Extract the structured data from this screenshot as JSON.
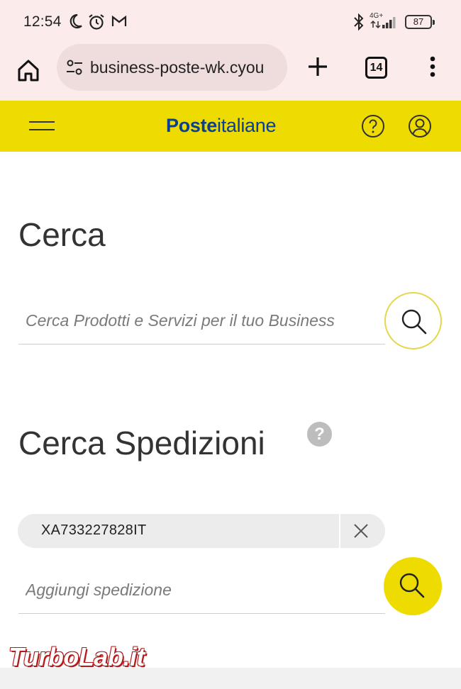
{
  "status_bar": {
    "time": "12:54",
    "network": "4G+",
    "battery": "87"
  },
  "browser": {
    "url": "business-poste-wk.cyou",
    "tab_count": "14"
  },
  "site_header": {
    "logo_bold": "Poste",
    "logo_rest": "italiane"
  },
  "search": {
    "heading": "Cerca",
    "placeholder": "Cerca Prodotti e Servizi per il tuo Business"
  },
  "shipments": {
    "heading": "Cerca Spedizioni",
    "help_glyph": "?",
    "tracking_code": "XA733227828IT",
    "add_placeholder": "Aggiungi spedizione"
  },
  "watermark": {
    "text": "TurboLab.it"
  },
  "colors": {
    "brand_yellow": "#eedc00",
    "brand_blue": "#0a3f93",
    "browser_chrome": "#fbeceb"
  },
  "icons": [
    "moon-icon",
    "alarm-icon",
    "gmail-icon",
    "bluetooth-icon",
    "signal-icon",
    "home-icon",
    "site-settings-icon",
    "plus-icon",
    "more-vert-icon",
    "hamburger-icon",
    "help-icon",
    "user-icon",
    "search-icon",
    "close-icon"
  ]
}
